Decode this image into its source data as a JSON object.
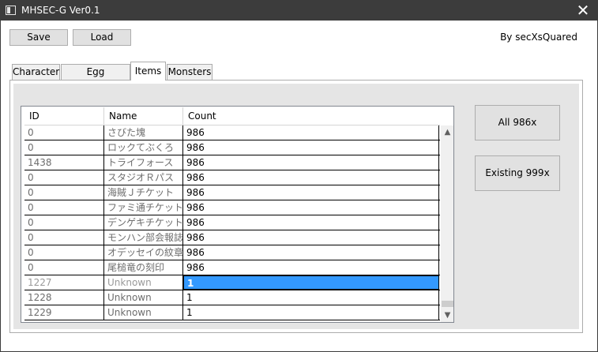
{
  "window": {
    "title": "MHSEC-G Ver0.1",
    "close_glyph": "✕"
  },
  "toolbar": {
    "save_label": "Save",
    "load_label": "Load",
    "credit": "By secXsQuared"
  },
  "tabs": [
    {
      "label": "Character",
      "active": false
    },
    {
      "label": "Egg Fragments",
      "active": false
    },
    {
      "label": "Items",
      "active": true
    },
    {
      "label": "Monsters",
      "active": false
    }
  ],
  "grid": {
    "columns": [
      "ID",
      "Name",
      "Count"
    ],
    "rows": [
      {
        "id": "0",
        "name": "さびた塊",
        "count": "986"
      },
      {
        "id": "0",
        "name": "ロックてぶくろ",
        "count": "986"
      },
      {
        "id": "1438",
        "name": "トライフォース",
        "count": "986"
      },
      {
        "id": "0",
        "name": "スタジオＲパス",
        "count": "986"
      },
      {
        "id": "0",
        "name": "海賊Ｊチケット",
        "count": "986"
      },
      {
        "id": "0",
        "name": "ファミ通チケット",
        "count": "986"
      },
      {
        "id": "0",
        "name": "デンゲキチケット",
        "count": "986"
      },
      {
        "id": "0",
        "name": "モンハン部会報誌",
        "count": "986"
      },
      {
        "id": "0",
        "name": "オデッセイの紋章",
        "count": "986"
      },
      {
        "id": "0",
        "name": "尾槌竜の刻印",
        "count": "986"
      },
      {
        "id": "1227",
        "name": "Unknown",
        "count": "1",
        "selected": true
      },
      {
        "id": "1228",
        "name": "Unknown",
        "count": "1"
      },
      {
        "id": "1229",
        "name": "Unknown",
        "count": "1"
      }
    ]
  },
  "actions": {
    "all_label": "All 986x",
    "existing_label": "Existing 999x"
  },
  "icons": {
    "scroll_up": "▲",
    "scroll_down": "▼",
    "app_icon": "window-icon"
  }
}
